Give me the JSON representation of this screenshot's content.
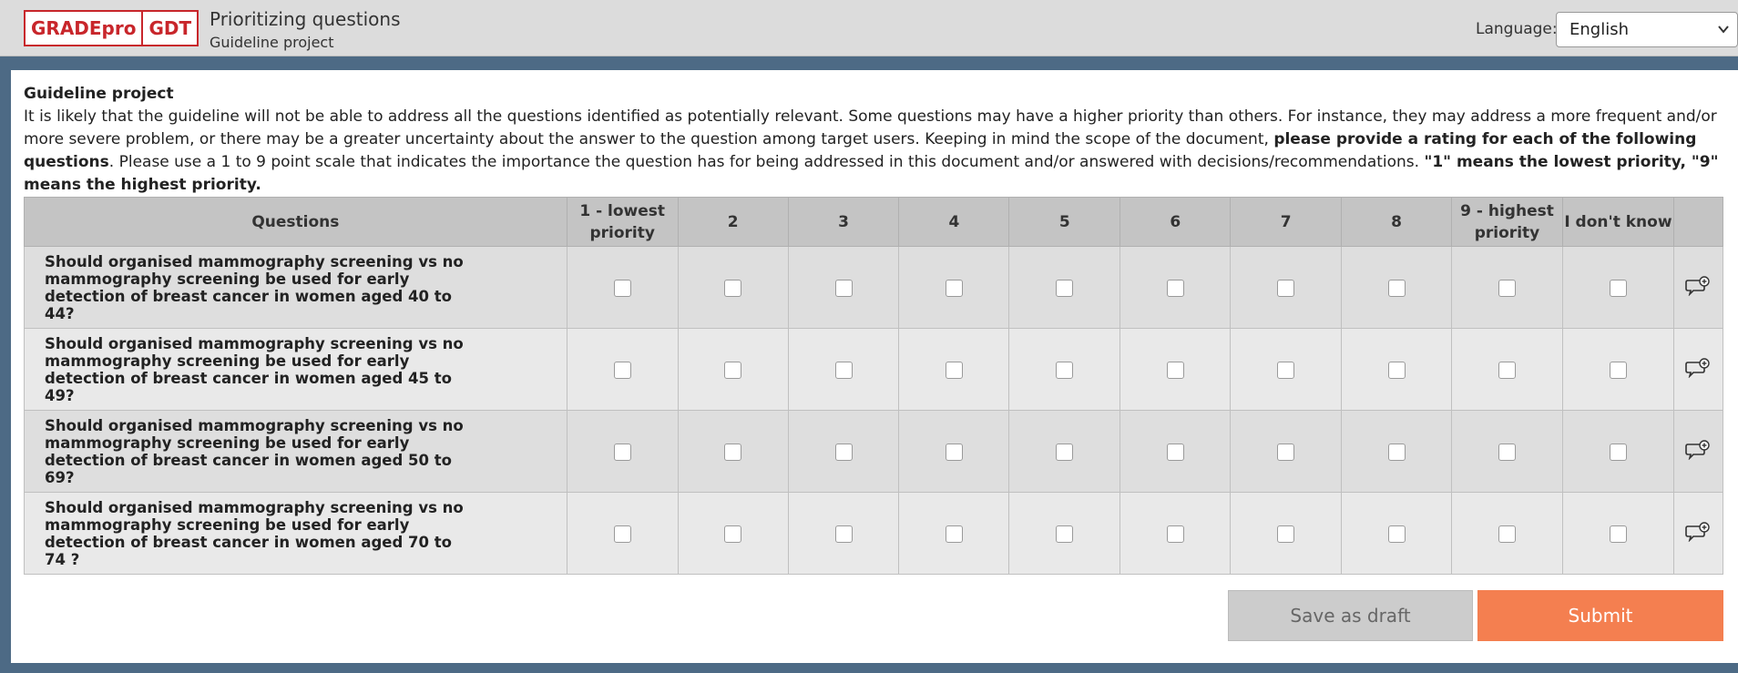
{
  "header": {
    "logo_left": "GRADEpro",
    "logo_right": "GDT",
    "title": "Prioritizing questions",
    "subtitle": "Guideline project",
    "language_label": "Language:",
    "language_value": "English"
  },
  "intro": {
    "heading": "Guideline project",
    "text_1": "It is likely that the guideline will not be able to address all the questions identified as potentially relevant. Some questions may have a higher priority than others. For instance, they may address a more frequent and/or more severe problem, or there may be a greater uncertainty about the answer to the question among target users. Keeping in mind the scope of the document, ",
    "bold_1": "please provide a rating for each of the following questions",
    "text_2": ". Please use a 1 to 9 point scale that indicates the importance the question has for being addressed in this document and/or answered with decisions/recommendations. ",
    "bold_2": "\"1\" means the lowest priority, \"9\" means the highest priority."
  },
  "table": {
    "headers": {
      "questions": "Questions",
      "r1_line1": "1 - lowest",
      "r1_line2": "priority",
      "r2": "2",
      "r3": "3",
      "r4": "4",
      "r5": "5",
      "r6": "6",
      "r7": "7",
      "r8": "8",
      "r9_line1": "9 - highest",
      "r9_line2": "priority",
      "dont_know": "I don't know"
    },
    "rows": [
      {
        "question": "Should organised mammography screening vs no mammography screening be used for early detection of breast cancer in women aged 40 to 44?"
      },
      {
        "question": "Should organised mammography screening vs no mammography screening be used for early detection of breast cancer in women aged 45 to 49?"
      },
      {
        "question": "Should organised mammography screening vs no mammography screening be used for early detection of breast cancer in women aged 50 to 69?"
      },
      {
        "question": "Should organised mammography screening vs no mammography screening be used for early detection of breast cancer in women aged 70 to 74 ?"
      }
    ]
  },
  "buttons": {
    "save_draft": "Save as draft",
    "submit": "Submit"
  },
  "colors": {
    "accent_submit": "#f47f50",
    "logo_red": "#c8262b",
    "frame": "#4d6a85"
  },
  "icons": {
    "comment": "comment-add-icon",
    "dropdown": "chevron-down-icon"
  }
}
